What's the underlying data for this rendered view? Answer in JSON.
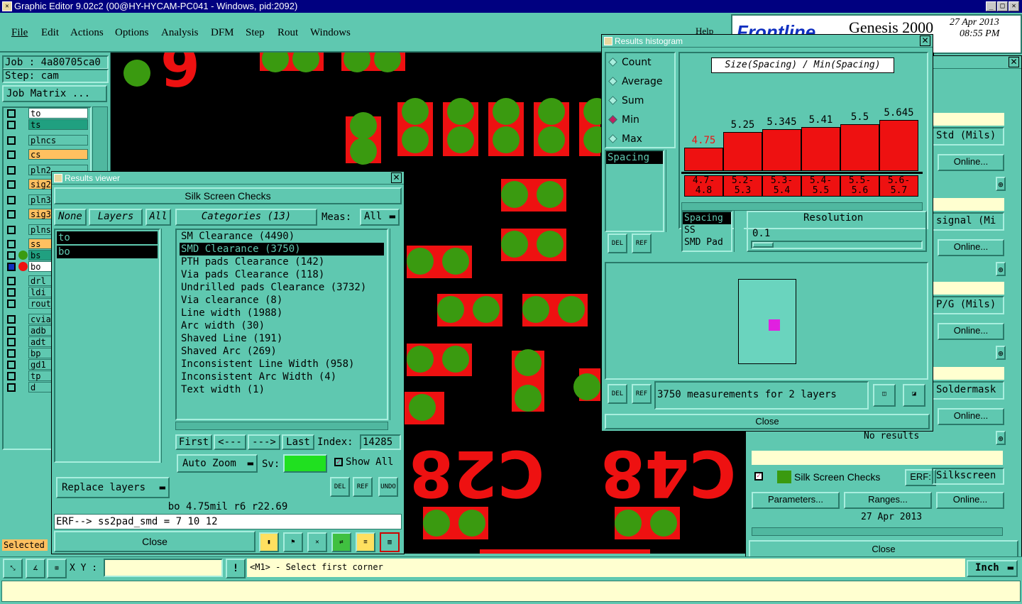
{
  "app": {
    "title": "Graphic Editor 9.02c2 (00@HY-HYCAM-PC041 - Windows, pid:2092)",
    "min": "_",
    "max": "□",
    "close": "✕"
  },
  "menu": [
    "File",
    "Edit",
    "Actions",
    "Options",
    "Analysis",
    "DFM",
    "Step",
    "Rout",
    "Windows"
  ],
  "help": "Help",
  "brand": {
    "logo": "Frontline",
    "product": "Genesis 2000",
    "date": "27 Apr 2013",
    "time": "08:55 PM"
  },
  "job": {
    "job_label": "Job : 4a80705ca0",
    "step_label": "Step: cam",
    "matrix_btn": "Job Matrix ..."
  },
  "layers": [
    {
      "name": "to",
      "bg": "#ffffff"
    },
    {
      "name": "ts",
      "bg": "#20a080"
    },
    {
      "name": "plncs",
      "bg": "#5fc8b0"
    },
    {
      "name": "cs",
      "bg": "#ffc060"
    },
    {
      "name": "pln2",
      "bg": "#5fc8b0"
    },
    {
      "name": "sig2",
      "bg": "#ffc060"
    },
    {
      "name": "pln3",
      "bg": "#5fc8b0"
    },
    {
      "name": "sig3",
      "bg": "#ffc060"
    },
    {
      "name": "plnss",
      "bg": "#5fc8b0"
    },
    {
      "name": "ss",
      "bg": "#ffc060"
    },
    {
      "name": "bs",
      "bg": "#20a080"
    },
    {
      "name": "bo",
      "bg": "#ffffff"
    },
    {
      "name": "drl",
      "bg": "#5fc8b0"
    },
    {
      "name": "ldi",
      "bg": "#5fc8b0"
    },
    {
      "name": "rout",
      "bg": "#5fc8b0"
    },
    {
      "name": "cvia",
      "bg": "#5fc8b0"
    },
    {
      "name": "adb",
      "bg": "#5fc8b0"
    },
    {
      "name": "adt",
      "bg": "#5fc8b0"
    },
    {
      "name": "bp",
      "bg": "#5fc8b0"
    },
    {
      "name": "gd1",
      "bg": "#5fc8b0"
    },
    {
      "name": "tp",
      "bg": "#5fc8b0"
    },
    {
      "name": "d",
      "bg": "#5fc8b0"
    }
  ],
  "selected_label": "Selected",
  "canvas_text": {
    "c28": "C28",
    "c48": "C48",
    "nine": "6"
  },
  "results_viewer": {
    "title": "Results viewer",
    "header": "Silk Screen Checks",
    "none_btn": "None",
    "layers_btn": "Layers",
    "all_btn": "All",
    "layer_items": [
      "to",
      "bo"
    ],
    "categories_btn": "Categories (13)",
    "meas_label": "Meas:",
    "meas_value": "All",
    "categories": [
      "SM Clearance (4490)",
      "SMD Clearance (3750)",
      "PTH pads Clearance (142)",
      "Via pads Clearance (118)",
      "Undrilled pads Clearance (3732)",
      "Via clearance (8)",
      "Line width (1988)",
      "Arc width (30)",
      "Shaved Line (191)",
      "Shaved Arc (269)",
      "Inconsistent Line Width (958)",
      "Inconsistent Arc Width (4)",
      "Text width (1)"
    ],
    "first_btn": "First",
    "prev_btn": "<---",
    "next_btn": "--->",
    "last_btn": "Last",
    "index_label": "Index:",
    "index_value": "14285",
    "auto_zoom": "Auto Zoom",
    "sv_label": "Sv:",
    "show_all": "Show All",
    "replace_layers": "Replace layers",
    "del": "DEL",
    "ref": "REF",
    "undo": "UNDO",
    "info": "bo 4.75mil  r6  r22.69",
    "erf": "ERF--> ss2pad_smd = 7 10 12",
    "close_btn": "Close"
  },
  "histogram": {
    "title": "Results histogram",
    "modes": [
      "Count",
      "Average",
      "Sum",
      "Min",
      "Max"
    ],
    "selected_mode": "Min",
    "chart_title": "Size(Spacing) / Min(Spacing)",
    "bar_values": [
      "4.75",
      "5.25",
      "5.345",
      "5.41",
      "5.5",
      "5.645"
    ],
    "bar_ranges": [
      "4.7-\n4.8",
      "5.2-\n5.3",
      "5.3-\n5.4",
      "5.4-\n5.5",
      "5.5-\n5.6",
      "5.6-\n5.7"
    ],
    "left_list": [
      "Spacing"
    ],
    "measure_list": [
      "Spacing",
      "SS",
      "SMD Pad"
    ],
    "resolution_label": "Resolution",
    "resolution_value": "0.1",
    "status": "3750 measurements for 2 layers",
    "close_btn": "Close",
    "del": "DEL",
    "ref": "REF"
  },
  "right_panel": {
    "rows": [
      {
        "label": "Std (Mils)",
        "btn": "Online..."
      },
      {
        "label": "signal (Mi",
        "btn": "Online..."
      },
      {
        "label": "P/G (Mils)",
        "btn": "Online..."
      },
      {
        "label": "Soldermask",
        "btn": "Online..."
      }
    ],
    "no_results": "No results",
    "check_name": "Silk Screen Checks",
    "erf_label": "ERF:",
    "erf_value": "Silkscreen",
    "parameters_btn": "Parameters...",
    "ranges_btn": "Ranges...",
    "online_btn": "Online...",
    "date": "27 Apr 2013",
    "close_btn": "Close"
  },
  "bottom": {
    "xy_label": "X Y :",
    "xy_value": "",
    "prompt": "<M1> - Select first corner",
    "units": "Inch"
  }
}
